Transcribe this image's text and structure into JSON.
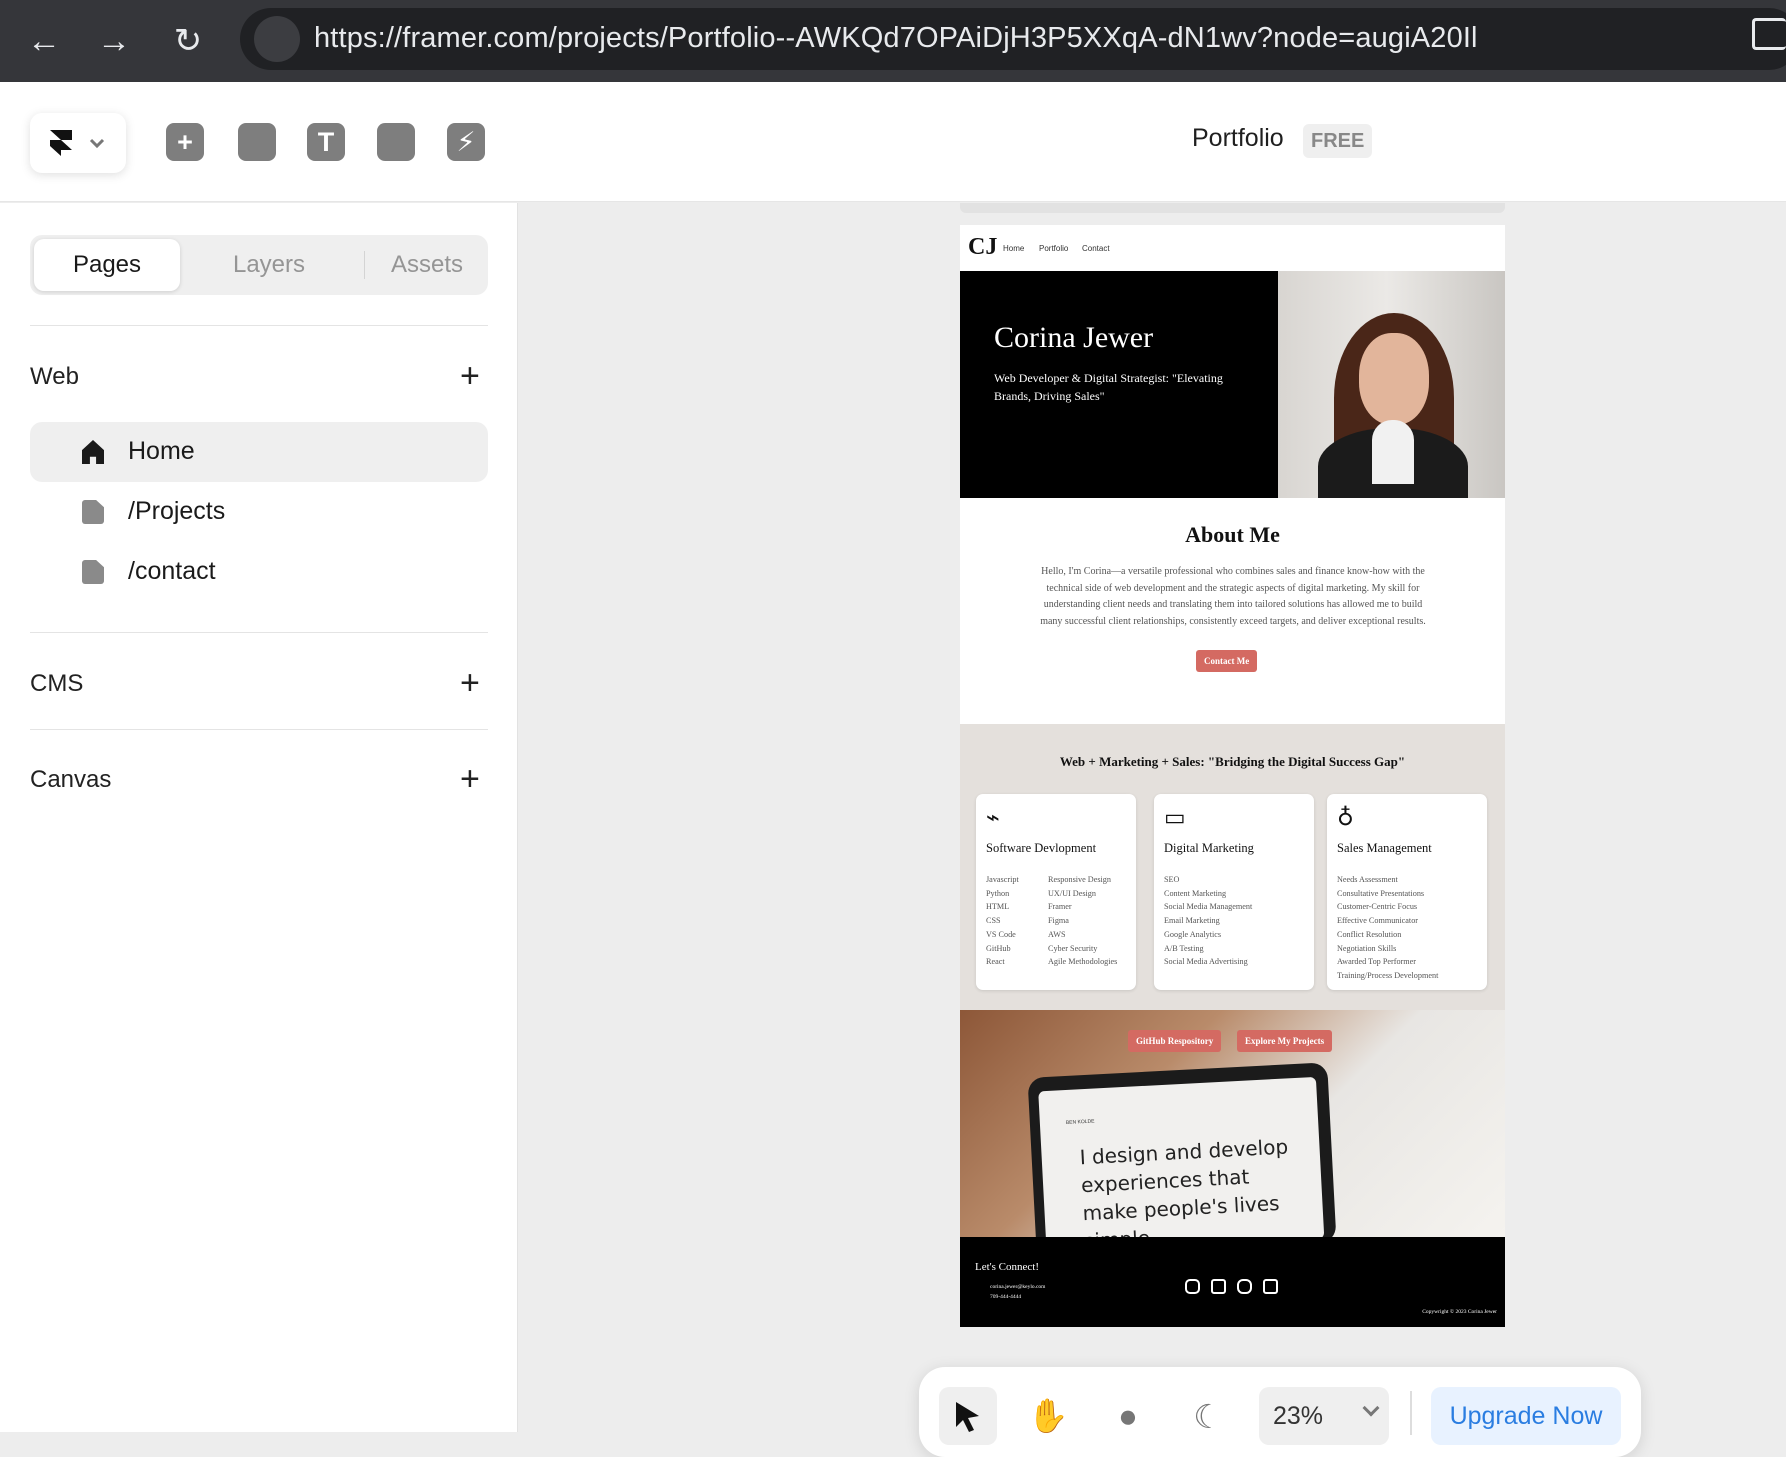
{
  "browser": {
    "url": "https://framer.com/projects/Portfolio--AWKQd7OPAiDjH3P5XXqA-dN1wv?node=augiA20Il",
    "back_label": "←",
    "forward_label": "→",
    "reload_label": "↻"
  },
  "toolbar": {
    "project_title": "Portfolio",
    "plan_badge": "FREE",
    "icons": [
      "framer-logo-icon",
      "insert-icon",
      "layout-icon",
      "text-icon",
      "cms-icon",
      "interactions-icon"
    ]
  },
  "sidebar": {
    "tabs": [
      "Pages",
      "Layers",
      "Assets"
    ],
    "sections": {
      "web": "Web",
      "cms": "CMS",
      "canvas": "Canvas"
    },
    "pages": [
      "Home",
      "/Projects",
      "/contact"
    ],
    "plus": "+"
  },
  "site": {
    "logo": "CJ",
    "nav": [
      "Home",
      "Portfolio",
      "Contact"
    ],
    "hero_name": "Corina Jewer",
    "hero_subtitle": "Web Developer & Digital Strategist: \"Elevating Brands, Driving Sales\"",
    "about_title": "About Me",
    "about_text": "Hello, I'm Corina—a versatile professional who combines sales and finance know-how with the technical side of web development and the strategic aspects of digital marketing. My skill for understanding client needs and translating them into tailored solutions has allowed me to build many successful client relationships, consistently exceed targets, and deliver exceptional results.",
    "contact_button": "Contact Me",
    "skills_title": "Web + Marketing + Sales: \"Bridging the Digital Success Gap\"",
    "cards": [
      {
        "title": "Software Devlopment",
        "col1": [
          "Javascript",
          "Python",
          "HTML",
          "CSS",
          "VS Code",
          "GitHub",
          "React"
        ],
        "col2": [
          "Responsive Design",
          "UX/UI Design",
          "Framer",
          "Figma",
          "AWS",
          "Cyber Security",
          "Agile Methodologies"
        ]
      },
      {
        "title": "Digital Marketing",
        "col1": [
          "SEO",
          "Content Marketing",
          "Social Media Management",
          "Email Marketing",
          "Google Analytics",
          "A/B Testing",
          "Social Media Advertising"
        ]
      },
      {
        "title": "Sales Management",
        "col1": [
          "Needs Assessment",
          "Consultative Presentations",
          "Customer-Centric Focus",
          "Effective Communicator",
          "Conflict Resolution",
          "Negotiation Skills",
          "Awarded Top Performer",
          "Training/Process Development"
        ]
      }
    ],
    "github_button": "GitHub Respository",
    "projects_button": "Explore My Projects",
    "laptop_brand": "BEN KOLDE",
    "laptop_text": "I design and develop experiences that make people's lives simple.",
    "footer_title": "Let's Connect!",
    "footer_email": "corina.jewer@keylo.com",
    "footer_phone": "709-444-4444",
    "copyright": "Copywright © 2023 Corina Jewer"
  },
  "bottom_toolbar": {
    "zoom": "23%",
    "upgrade_label": "Upgrade Now"
  },
  "colors": {
    "browser_bar": "#35363a",
    "accent_red": "#d46a62",
    "upgrade_blue": "#2a7de1"
  }
}
